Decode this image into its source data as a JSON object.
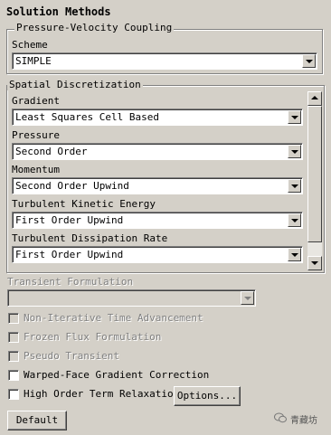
{
  "panel_title": "Solution Methods",
  "pv_coupling": {
    "legend": "Pressure-Velocity Coupling",
    "scheme_label": "Scheme",
    "scheme_value": "SIMPLE"
  },
  "spatial": {
    "legend": "Spatial Discretization",
    "rows": [
      {
        "label": "Gradient",
        "value": "Least Squares Cell Based"
      },
      {
        "label": "Pressure",
        "value": "Second Order"
      },
      {
        "label": "Momentum",
        "value": "Second Order Upwind"
      },
      {
        "label": "Turbulent Kinetic Energy",
        "value": "First Order Upwind"
      },
      {
        "label": "Turbulent Dissipation Rate",
        "value": "First Order Upwind"
      }
    ]
  },
  "transient": {
    "label": "Transient Formulation",
    "value": ""
  },
  "checkboxes": [
    {
      "label": "Non-Iterative Time Advancement",
      "checked": false,
      "enabled": false
    },
    {
      "label": "Frozen Flux Formulation",
      "checked": false,
      "enabled": false
    },
    {
      "label": "Pseudo Transient",
      "checked": false,
      "enabled": false
    },
    {
      "label": "Warped-Face Gradient Correction",
      "checked": false,
      "enabled": true
    },
    {
      "label": "High Order Term Relaxation",
      "checked": false,
      "enabled": true
    }
  ],
  "options_button": "Options...",
  "default_button": "Default",
  "watermark": "青藏坊"
}
